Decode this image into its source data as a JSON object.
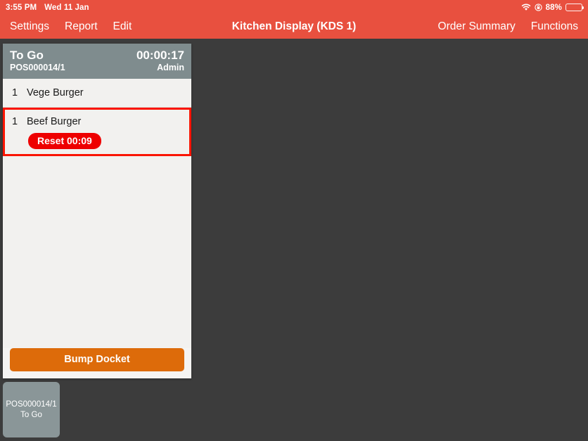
{
  "statusbar": {
    "time": "3:55 PM",
    "date": "Wed 11 Jan",
    "wifi_icon": "wifi-icon",
    "lock_icon": "rotation-lock-icon",
    "battery_percent": "88%",
    "battery_icon": "battery-icon",
    "battery_level": 88
  },
  "toolbar": {
    "settings_label": "Settings",
    "report_label": "Report",
    "edit_label": "Edit",
    "title": "Kitchen Display (KDS 1)",
    "order_summary_label": "Order Summary",
    "functions_label": "Functions"
  },
  "docket": {
    "header": {
      "title": "To Go",
      "reference": "POS000014/1",
      "timer": "00:00:17",
      "user": "Admin"
    },
    "items": [
      {
        "qty": "1",
        "name": "Vege Burger",
        "selected": false,
        "reset_label": null
      },
      {
        "qty": "1",
        "name": "Beef Burger",
        "selected": true,
        "reset_label": "Reset 00:09"
      }
    ],
    "bump_label": "Bump Docket"
  },
  "tray": {
    "tiles": [
      {
        "reference": "POS000014/1",
        "title": "To Go"
      }
    ]
  },
  "colors": {
    "toolbar_red": "#e8503f",
    "docket_header_gray": "#7f8c8e",
    "card_bg": "#f5f4f2",
    "stage_bg": "#3c3c3c",
    "reset_red": "#ee0000",
    "highlight_red": "#fa1400",
    "bump_orange": "#dd6b0a",
    "tray_tile_gray": "#8a9698"
  }
}
